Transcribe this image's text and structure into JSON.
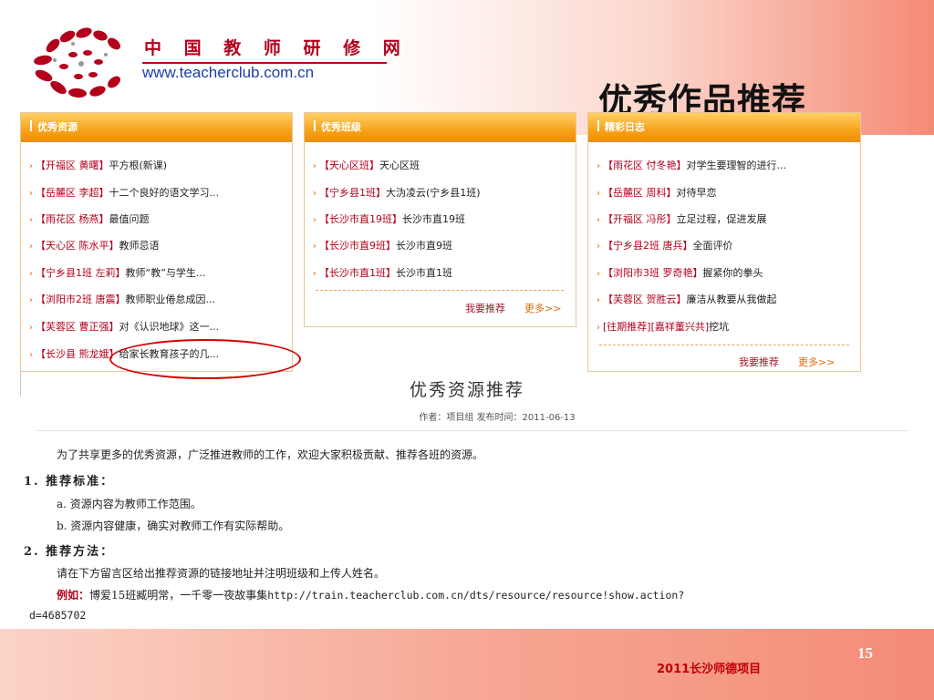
{
  "header": {
    "site_name": "中 国 教 师 研 修 网",
    "site_url": "www.teacherclub.com.cn",
    "slide_title": "优秀作品推荐"
  },
  "panels": [
    {
      "title": "优秀资源",
      "items": [
        {
          "tag": "【开福区 黄曙】",
          "text": "平方根(新课)"
        },
        {
          "tag": "【岳麓区 李超】",
          "text": "十二个良好的语文学习..."
        },
        {
          "tag": "【雨花区 杨燕】",
          "text": "最值问题"
        },
        {
          "tag": "【天心区 陈水平】",
          "text": "教师忌语"
        },
        {
          "tag": "【宁乡县1班 左莉】",
          "text": "教师“教”与学生..."
        },
        {
          "tag": "【浏阳市2班 唐震】",
          "text": "教师职业倦怠成因..."
        },
        {
          "tag": "【芙蓉区 曹正强】",
          "text": "对《认识地球》这一..."
        },
        {
          "tag": "【长沙县 熊龙娥】",
          "text": "给家长教育孩子的几..."
        }
      ]
    },
    {
      "title": "优秀班级",
      "items": [
        {
          "tag": "【天心区班】",
          "text": "天心区班"
        },
        {
          "tag": "【宁乡县1班】",
          "text": "大沩凌云(宁乡县1班)"
        },
        {
          "tag": "【长沙市直19班】",
          "text": "长沙市直19班"
        },
        {
          "tag": "【长沙市直9班】",
          "text": "长沙市直9班"
        },
        {
          "tag": "【长沙市直1班】",
          "text": "长沙市直1班"
        }
      ],
      "recommend_label": "我要推荐",
      "more_label": "更多>>"
    },
    {
      "title": "精彩日志",
      "items": [
        {
          "tag": "【雨花区 付冬艳】",
          "text": "对学生要理智的进行..."
        },
        {
          "tag": "【岳麓区 周科】",
          "text": "对待早恋"
        },
        {
          "tag": "【开福区 冯彤】",
          "text": "立足过程，促进发展"
        },
        {
          "tag": "【宁乡县2班 唐兵】",
          "text": "全面评价"
        },
        {
          "tag": "【浏阳市3班 罗奇艳】",
          "text": "握紧你的拳头"
        },
        {
          "tag": "【芙蓉区 贺胜云】",
          "text": "廉洁从教要从我做起"
        },
        {
          "tag": "[往期推荐][嘉祥董兴共]",
          "text": "挖坑"
        }
      ],
      "recommend_label": "我要推荐",
      "more_label": "更多>>"
    }
  ],
  "article": {
    "title": "优秀资源推荐",
    "meta": "作者：项目组    发布时间：2011-06-13",
    "intro": "为了共享更多的优秀资源，广泛推进教师的工作，欢迎大家积极贡献、推荐各班的资源。",
    "heading1": "1. 推荐标准：",
    "item_a": "a. 资源内容为教师工作范围。",
    "item_b": "b. 资源内容健康，确实对教师工作有实际帮助。",
    "heading2": "2. 推荐方法：",
    "method": "请在下方留言区给出推荐资源的链接地址并注明班级和上传人姓名。",
    "example_label": "例如：",
    "example_text": "博爱15班臧明常，一千零一夜故事集",
    "example_url": "http://train.teacherclub.com.cn/dts/resource/resource!show.action?",
    "example_url_cont": "d=4685702"
  },
  "footer": {
    "page_number": "15",
    "text": "2011长沙师德项目"
  },
  "colors": {
    "accent_red": "#b3001b",
    "panel_orange": "#f7a21b",
    "footer_salmon": "#f38b76"
  }
}
